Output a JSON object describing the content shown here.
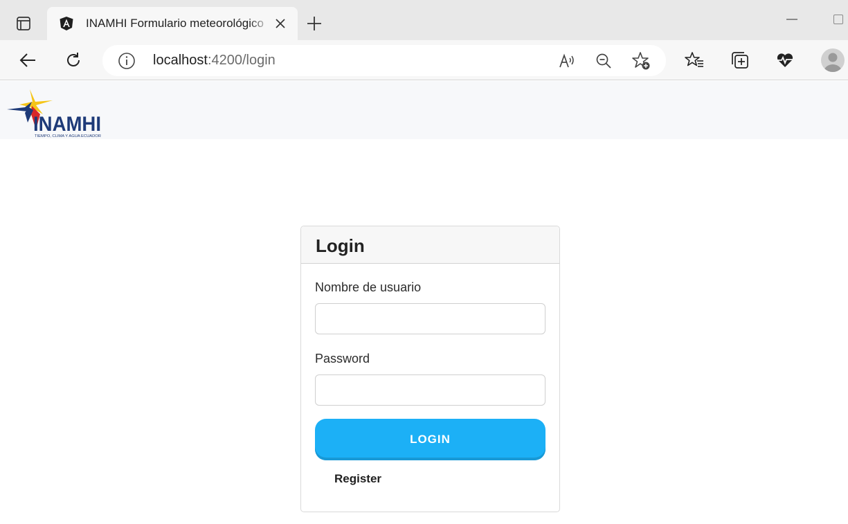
{
  "browser": {
    "tab": {
      "title": "INAMHI Formulario meteorológico",
      "favicon": "angular-icon"
    },
    "address": {
      "host": "localhost",
      "path": ":4200/login"
    },
    "toolbar_icons": [
      "back-arrow-icon",
      "reload-icon",
      "site-info-icon",
      "read-aloud-icon",
      "zoom-out-icon",
      "add-favorite-icon",
      "favorites-icon",
      "collections-icon",
      "browser-essentials-icon",
      "profile-avatar-icon"
    ]
  },
  "header": {
    "logo_text": "INAMHI",
    "logo_tagline": "TIEMPO, CLIMA Y AGUA ECUADOR"
  },
  "login": {
    "title": "Login",
    "username_label": "Nombre de usuario",
    "username_value": "",
    "password_label": "Password",
    "password_value": "",
    "submit_label": "LOGIN",
    "register_label": "Register"
  },
  "colors": {
    "primary_button": "#1cb0f6",
    "header_bg": "#f7f8fa",
    "logo_blue": "#1e3a78",
    "logo_yellow": "#f5c518",
    "logo_red": "#d62828"
  }
}
